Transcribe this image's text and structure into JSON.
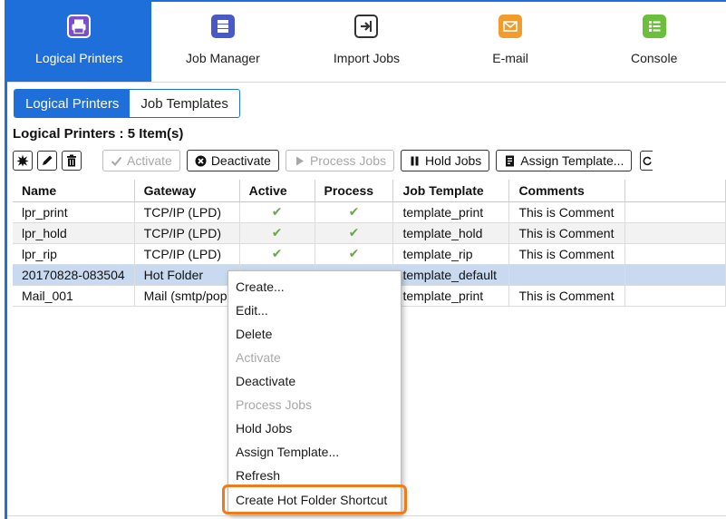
{
  "colors": {
    "accent": "#1e6fd9",
    "highlight": "#f07b1a",
    "check": "#6aa84f"
  },
  "nav": [
    {
      "label": "Logical Printers",
      "icon": "printer-icon",
      "active": true,
      "color": "#7b4fc9"
    },
    {
      "label": "Job Manager",
      "icon": "job-manager-icon",
      "active": false,
      "color": "#4a5ac4"
    },
    {
      "label": "Import Jobs",
      "icon": "import-icon",
      "active": false,
      "color": "#333333"
    },
    {
      "label": "E-mail",
      "icon": "email-icon",
      "active": false,
      "color": "#f39c2d"
    },
    {
      "label": "Console",
      "icon": "console-icon",
      "active": false,
      "color": "#6cbf3a"
    }
  ],
  "tabs": {
    "logical_printers": "Logical Printers",
    "job_templates": "Job Templates"
  },
  "section_title": "Logical Printers : 5 Item(s)",
  "toolbar": {
    "activate": "Activate",
    "deactivate": "Deactivate",
    "process_jobs": "Process Jobs",
    "hold_jobs": "Hold Jobs",
    "assign_template": "Assign Template..."
  },
  "table": {
    "headers": [
      "Name",
      "Gateway",
      "Active",
      "Process",
      "Job Template",
      "Comments"
    ],
    "rows": [
      {
        "name": "lpr_print",
        "gateway": "TCP/IP (LPD)",
        "active": "✔",
        "process": "✔",
        "template": "template_print",
        "comment": "This is Comment"
      },
      {
        "name": "lpr_hold",
        "gateway": "TCP/IP (LPD)",
        "active": "✔",
        "process": "✔",
        "template": "template_hold",
        "comment": "This is Comment"
      },
      {
        "name": "lpr_rip",
        "gateway": "TCP/IP (LPD)",
        "active": "✔",
        "process": "✔",
        "template": "template_rip",
        "comment": "This is Comment"
      },
      {
        "name": "20170828-083504",
        "gateway": "Hot Folder",
        "active": "",
        "process": "",
        "template": "template_default",
        "comment": ""
      },
      {
        "name": "Mail_001",
        "gateway": "Mail (smtp/pop",
        "active": "",
        "process": "",
        "template": "template_print",
        "comment": "This is Comment"
      }
    ]
  },
  "context_menu": [
    {
      "label": "Create...",
      "enabled": true
    },
    {
      "label": "Edit...",
      "enabled": true
    },
    {
      "label": "Delete",
      "enabled": true
    },
    {
      "label": "Activate",
      "enabled": false
    },
    {
      "label": "Deactivate",
      "enabled": true
    },
    {
      "label": "Process Jobs",
      "enabled": false
    },
    {
      "label": "Hold Jobs",
      "enabled": true
    },
    {
      "label": "Assign Template...",
      "enabled": true
    },
    {
      "label": "Refresh",
      "enabled": true
    },
    {
      "label": "Create Hot Folder Shortcut",
      "enabled": true,
      "highlighted": true
    }
  ]
}
